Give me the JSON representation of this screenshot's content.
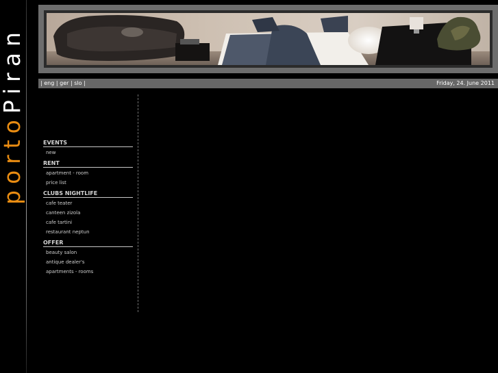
{
  "logo": {
    "part1": "porto",
    "part2": "Piran"
  },
  "languages": [
    "eng",
    "ger",
    "slo"
  ],
  "date": "Friday, 24. June 2011",
  "banner": {
    "alt": "apartment interior"
  },
  "nav": [
    {
      "heading": "EVENTS",
      "items": [
        "new"
      ]
    },
    {
      "heading": "RENT",
      "items": [
        "apartment - room",
        "price list"
      ]
    },
    {
      "heading": "CLUBS NIGHTLIFE",
      "items": [
        "cafe teater",
        "canteen zizola",
        "cafe tartini",
        "restaurant neptun"
      ]
    },
    {
      "heading": "OFFER",
      "items": [
        "beauty salon",
        "antique dealer's",
        "apartments - rooms"
      ]
    }
  ],
  "colors": {
    "accent": "#e98c12",
    "frame": "#6d6d6d",
    "bar": "#676767"
  }
}
